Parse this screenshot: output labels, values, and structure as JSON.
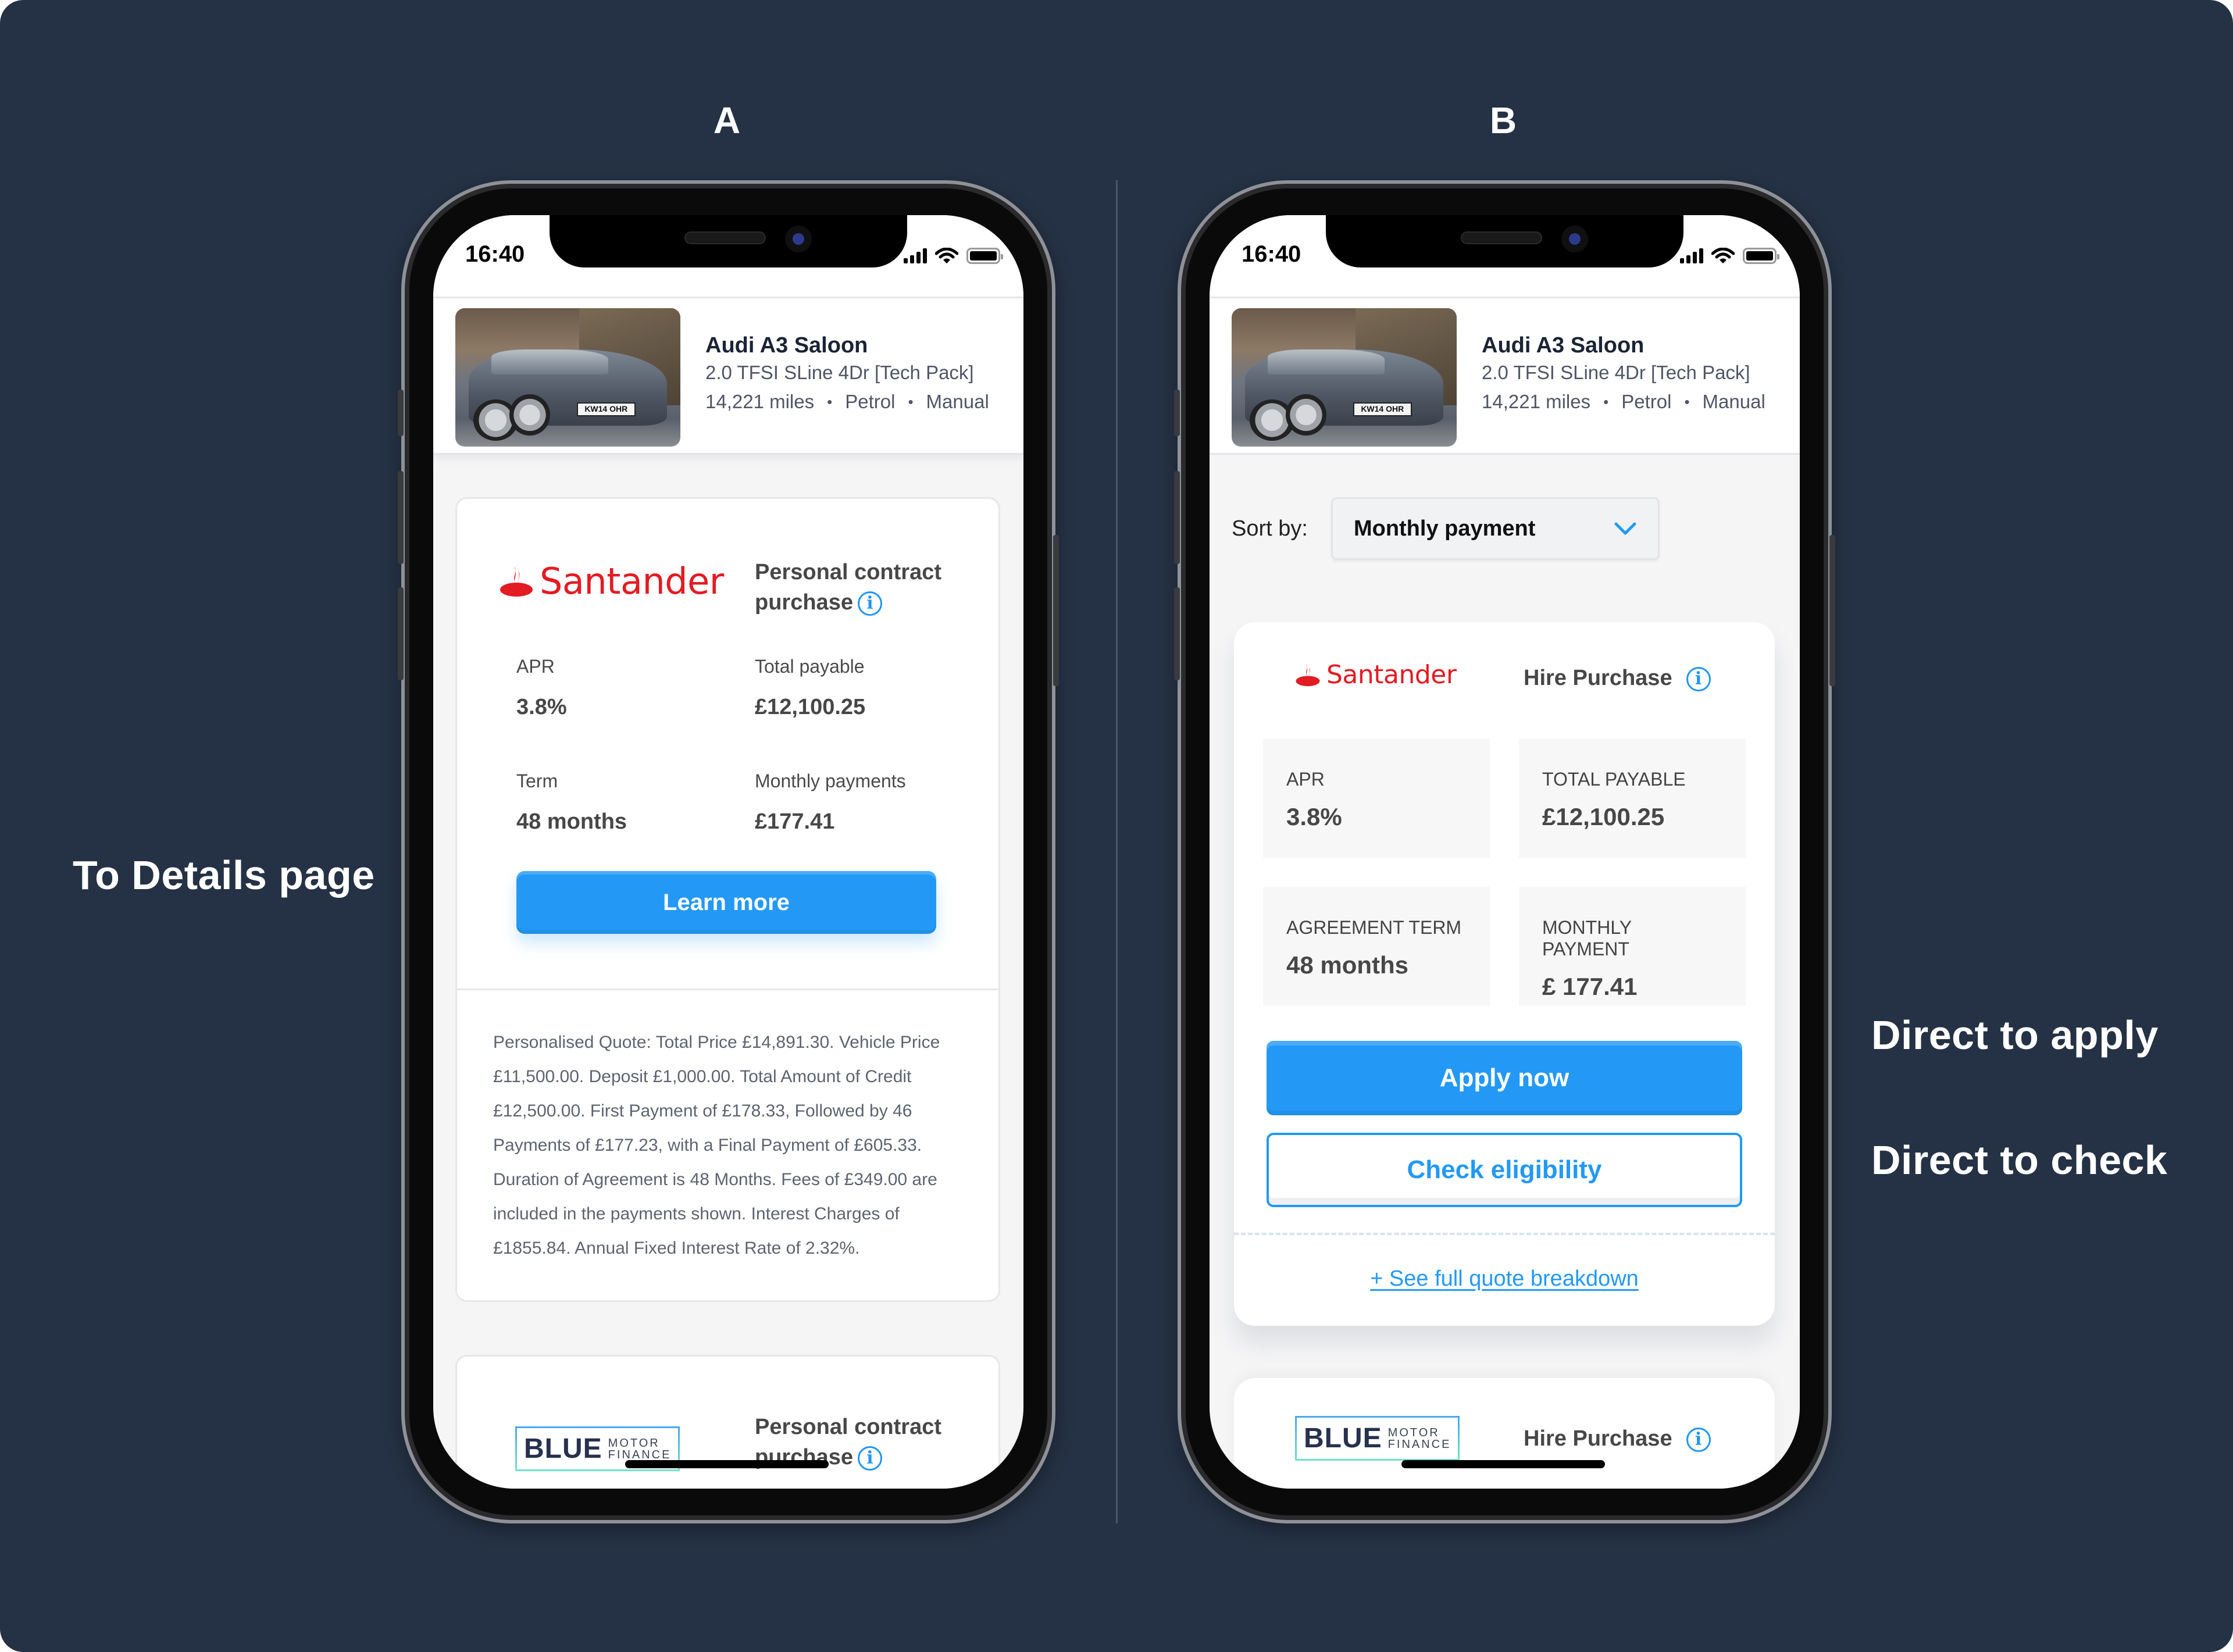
{
  "variants": {
    "a_label": "A",
    "b_label": "B"
  },
  "annotations": {
    "a_side": "To Details page",
    "b_apply": "Direct to apply",
    "b_check": "Direct to check"
  },
  "status_bar": {
    "time": "16:40",
    "icons": [
      "signal-icon",
      "wifi-icon",
      "battery-icon"
    ]
  },
  "car": {
    "title": "Audi A3 Saloon",
    "subtitle": "2.0 TFSI SLine 4Dr [Tech Pack]",
    "mileage": "14,221 miles",
    "fuel": "Petrol",
    "transmission": "Manual",
    "separator": "•",
    "plate": "KW14 OHR"
  },
  "variant_a": {
    "card": {
      "lender": "Santander",
      "product": "Personal contract purchase",
      "info_icon": "i",
      "stats": [
        {
          "label": "APR",
          "value": "3.8%"
        },
        {
          "label": "Total payable",
          "value": "£12,100.25"
        },
        {
          "label": "Term",
          "value": "48 months"
        },
        {
          "label": "Monthly payments",
          "value": "£177.41"
        }
      ],
      "cta": "Learn more",
      "disclaimer": "Personalised Quote: Total Price £14,891.30. Vehicle Price £11,500.00. Deposit £1,000.00. Total Amount of Credit £12,500.00. First Payment of £178.33, Followed by 46 Payments of £177.23, with a Final Payment of £605.33. Duration of Agreement is 48 Months. Fees of £349.00 are included in the payments shown. Interest Charges of £1855.84. Annual Fixed Interest Rate of 2.32%."
    },
    "next_card": {
      "lender_big": "BLUE",
      "lender_small_1": "MOTOR",
      "lender_small_2": "FINANCE",
      "product": "Personal contract purchase",
      "info_icon": "i"
    }
  },
  "variant_b": {
    "sort": {
      "label": "Sort by:",
      "selected": "Monthly payment"
    },
    "card": {
      "lender": "Santander",
      "product": "Hire Purchase",
      "info_icon": "i",
      "stats": [
        {
          "label": "APR",
          "value": "3.8%"
        },
        {
          "label": "TOTAL PAYABLE",
          "value": "£12,100.25"
        },
        {
          "label": "AGREEMENT TERM",
          "value": "48 months"
        },
        {
          "label": "MONTHLY PAYMENT",
          "value": "£ 177.41"
        }
      ],
      "apply": "Apply now",
      "check": "Check eligibility",
      "breakdown_link": "+ See full quote breakdown"
    },
    "next_card": {
      "lender_big": "BLUE",
      "lender_small_1": "MOTOR",
      "lender_small_2": "FINANCE",
      "product": "Hire Purchase",
      "info_icon": "i"
    }
  },
  "colors": {
    "background": "#253245",
    "accent_blue": "#2399f5",
    "santander_red": "#e31b23",
    "blue_motor_navy": "#27314f"
  }
}
